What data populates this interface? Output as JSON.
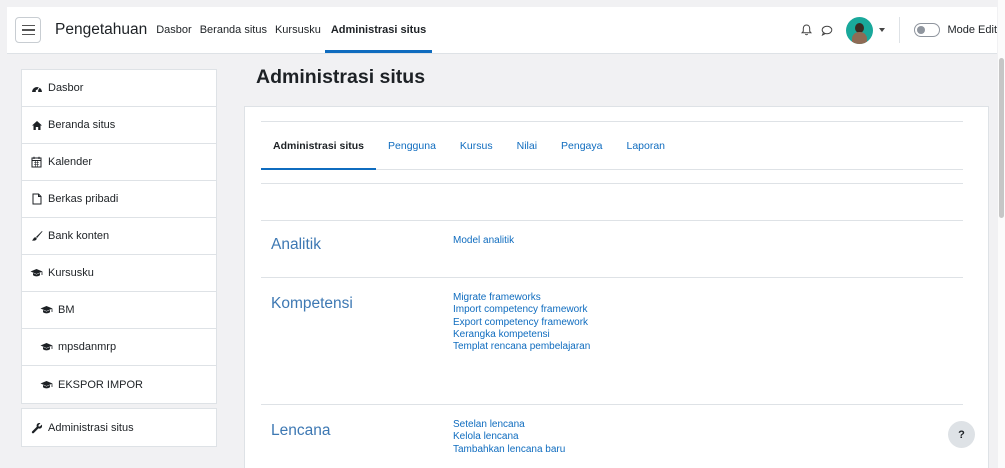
{
  "navbar": {
    "brand": "Pengetahuan",
    "items": [
      {
        "label": "Dasbor",
        "active": false
      },
      {
        "label": "Beranda situs",
        "active": false
      },
      {
        "label": "Kursusku",
        "active": false
      },
      {
        "label": "Administrasi situs",
        "active": true
      }
    ],
    "icons": [
      "bell-icon",
      "chat-icon"
    ],
    "mode_label": "Mode Edit"
  },
  "sidebar": {
    "items": [
      {
        "label": "Dasbor",
        "icon": "dashboard-icon"
      },
      {
        "label": "Beranda situs",
        "icon": "home-icon"
      },
      {
        "label": "Kalender",
        "icon": "calendar-icon"
      },
      {
        "label": "Berkas pribadi",
        "icon": "file-icon"
      },
      {
        "label": "Bank konten",
        "icon": "brush-icon"
      },
      {
        "label": "Kursusku",
        "icon": "graduation-cap-icon"
      },
      {
        "label": "BM",
        "icon": "graduation-cap-icon"
      },
      {
        "label": "mpsdanmrp",
        "icon": "graduation-cap-icon"
      },
      {
        "label": "EKSPOR IMPOR",
        "icon": "graduation-cap-icon"
      }
    ],
    "admin": {
      "label": "Administrasi situs",
      "icon": "wrench-icon"
    }
  },
  "main": {
    "title": "Administrasi situs",
    "tabs": [
      {
        "label": "Administrasi situs",
        "active": true
      },
      {
        "label": "Pengguna",
        "active": false
      },
      {
        "label": "Kursus",
        "active": false
      },
      {
        "label": "Nilai",
        "active": false
      },
      {
        "label": "Pengaya",
        "active": false
      },
      {
        "label": "Laporan",
        "active": false
      }
    ],
    "sections": [
      {
        "title": "Analitik",
        "links": [
          "Model analitik"
        ]
      },
      {
        "title": "Kompetensi",
        "links": [
          "Migrate frameworks",
          "Import competency framework",
          "Export competency framework",
          "Kerangka kompetensi",
          "Templat rencana pembelajaran"
        ]
      },
      {
        "title": "Lencana",
        "links": [
          "Setelan lencana",
          "Kelola lencana",
          "Tambahkan lencana baru"
        ]
      }
    ]
  },
  "help": {
    "label": "?"
  },
  "colors": {
    "accent": "#0f6cbf",
    "section_title": "#3d78b3",
    "background": "#f1f1f3"
  }
}
